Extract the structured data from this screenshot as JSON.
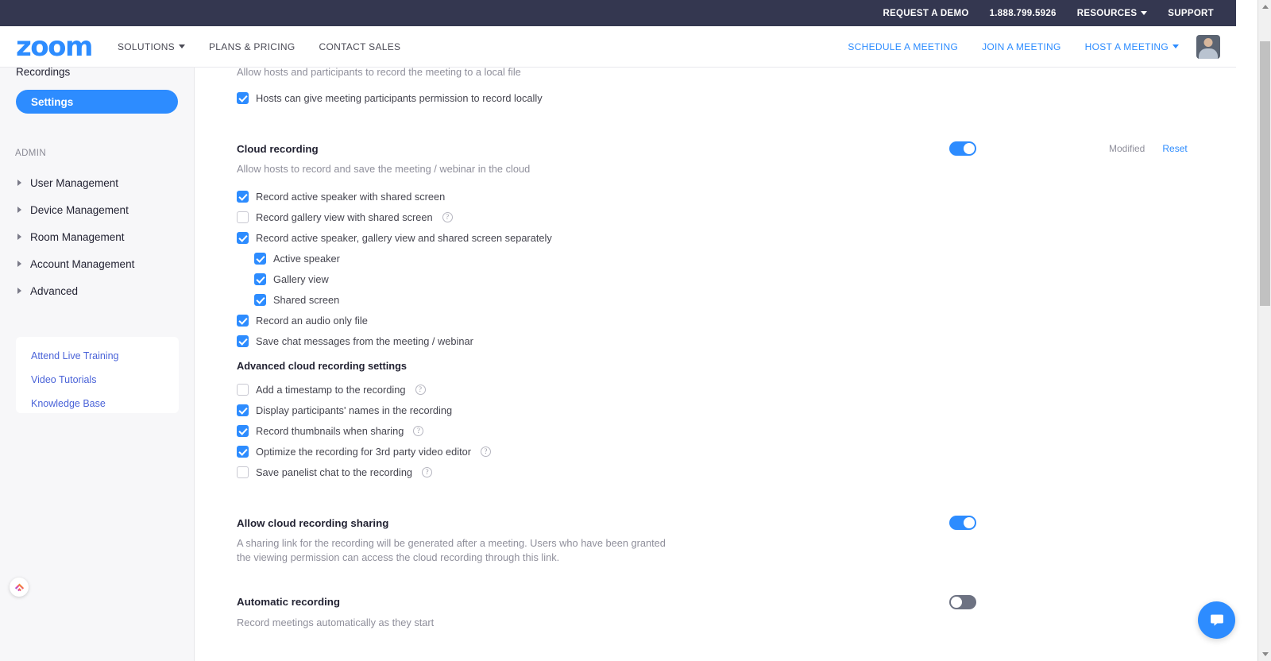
{
  "utility_bar": {
    "links": [
      {
        "label": "REQUEST A DEMO",
        "has_caret": false
      },
      {
        "label": "1.888.799.5926",
        "has_caret": false
      },
      {
        "label": "RESOURCES",
        "has_caret": true
      },
      {
        "label": "SUPPORT",
        "has_caret": false
      }
    ]
  },
  "header": {
    "logo": "zoom",
    "nav": [
      {
        "label": "SOLUTIONS",
        "has_caret": true
      },
      {
        "label": "PLANS & PRICING",
        "has_caret": false
      },
      {
        "label": "CONTACT SALES",
        "has_caret": false
      }
    ],
    "actions": [
      {
        "label": "SCHEDULE A MEETING",
        "has_caret": false
      },
      {
        "label": "JOIN A MEETING",
        "has_caret": false
      },
      {
        "label": "HOST A MEETING",
        "has_caret": true
      }
    ],
    "avatar_alt": "user-avatar"
  },
  "sidebar": {
    "partial_item": "Recordings",
    "active_item": "Settings",
    "admin_label": "ADMIN",
    "admin_items": [
      {
        "label": "User Management"
      },
      {
        "label": "Device Management"
      },
      {
        "label": "Room Management"
      },
      {
        "label": "Account Management"
      },
      {
        "label": "Advanced"
      }
    ],
    "help_links": [
      {
        "label": "Attend Live Training"
      },
      {
        "label": "Video Tutorials"
      },
      {
        "label": "Knowledge Base"
      }
    ]
  },
  "content": {
    "local_recording": {
      "description": "Allow hosts and participants to record the meeting to a local file",
      "checkbox": {
        "label": "Hosts can give meeting participants permission to record locally",
        "checked": true
      }
    },
    "cloud_recording": {
      "title": "Cloud recording",
      "description": "Allow hosts to record and save the meeting / webinar in the cloud",
      "toggle_on": true,
      "modified_label": "Modified",
      "reset_label": "Reset",
      "options": [
        {
          "label": "Record active speaker with shared screen",
          "checked": true,
          "help": false,
          "indent": false
        },
        {
          "label": "Record gallery view with shared screen",
          "checked": false,
          "help": true,
          "indent": false
        },
        {
          "label": "Record active speaker, gallery view and shared screen separately",
          "checked": true,
          "help": false,
          "indent": false
        },
        {
          "label": "Active speaker",
          "checked": true,
          "help": false,
          "indent": true
        },
        {
          "label": "Gallery view",
          "checked": true,
          "help": false,
          "indent": true
        },
        {
          "label": "Shared screen",
          "checked": true,
          "help": false,
          "indent": true
        },
        {
          "label": "Record an audio only file",
          "checked": true,
          "help": false,
          "indent": false
        },
        {
          "label": "Save chat messages from the meeting / webinar",
          "checked": true,
          "help": false,
          "indent": false
        }
      ],
      "advanced_title": "Advanced cloud recording settings",
      "advanced_options": [
        {
          "label": "Add a timestamp to the recording",
          "checked": false,
          "help": true,
          "indent": false
        },
        {
          "label": "Display participants' names in the recording",
          "checked": true,
          "help": false,
          "indent": false
        },
        {
          "label": "Record thumbnails when sharing",
          "checked": true,
          "help": true,
          "indent": false
        },
        {
          "label": "Optimize the recording for 3rd party video editor",
          "checked": true,
          "help": true,
          "indent": false
        },
        {
          "label": "Save panelist chat to the recording",
          "checked": false,
          "help": true,
          "indent": false
        }
      ]
    },
    "cloud_recording_sharing": {
      "title": "Allow cloud recording sharing",
      "description": "A sharing link for the recording will be generated after a meeting. Users who have been granted the viewing permission can access the cloud recording through this link.",
      "toggle_on": true
    },
    "automatic_recording": {
      "title": "Automatic recording",
      "description": "Record meetings automatically as they start",
      "toggle_on": false
    }
  },
  "colors": {
    "accent": "#2D8CFF",
    "dark_bar": "#343750",
    "toggle_off": "#6d7282",
    "sidebar_bg": "#f7f7f9",
    "muted_text": "#8f8f9b"
  },
  "chat_widget": {
    "icon": "chat-bubble-icon"
  }
}
